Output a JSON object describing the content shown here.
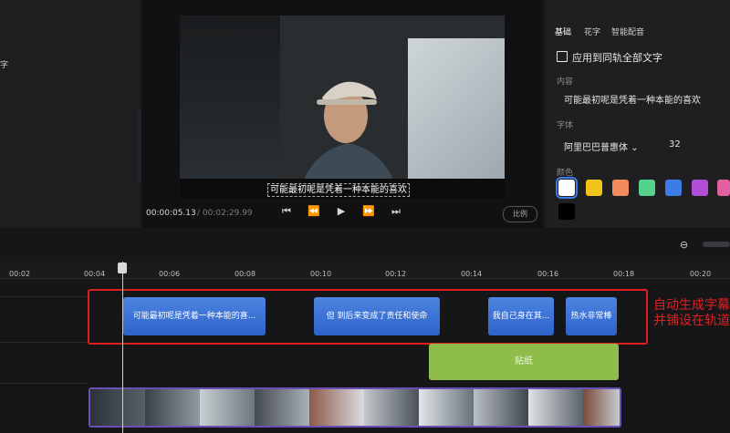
{
  "left_panel": {
    "edge_text": "字"
  },
  "preview": {
    "subtitle": "可能最初呢是凭着一种本能的喜欢",
    "time_current": "00:00:05.13",
    "time_total": "/ 00:02:29.99",
    "ratio_label": "比例",
    "controls": [
      "prev-frame",
      "rewind",
      "play",
      "forward",
      "next-frame"
    ]
  },
  "right_panel": {
    "tabs": [
      "基础",
      "花字",
      "智能配音"
    ],
    "apply_all_label": "应用到同轨全部文字",
    "content_label": "内容",
    "content_value": "可能最初呢是凭着一种本能的喜欢",
    "font_label": "字体",
    "font_value": "阿里巴巴普惠体",
    "font_size": "32",
    "color_label": "颜色",
    "colors": [
      "#ffffff",
      "#f0c419",
      "#f28b5c",
      "#54d18c",
      "#3c7ce6",
      "#b04fd6",
      "#e060a0",
      "#000000"
    ]
  },
  "timeline": {
    "ticks": [
      "00:02",
      "00:04",
      "00:06",
      "00:08",
      "00:10",
      "00:12",
      "00:14",
      "00:16",
      "00:18",
      "00:20"
    ],
    "subtitle_clips": [
      "可能最初呢是凭着一种本能的喜...",
      "但  到后来变成了责任和使命",
      "我自己身在其...",
      "热水非常棒"
    ],
    "annotation_line1": "自动生成字幕",
    "annotation_line2": "并铺设在轨道",
    "sticker_label": "贴纸"
  }
}
